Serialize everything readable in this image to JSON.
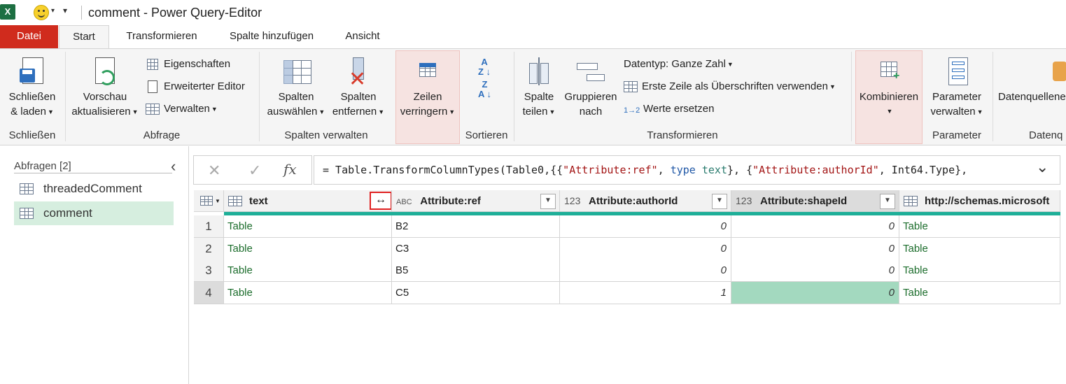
{
  "window": {
    "app_icon": "X",
    "title": "comment - Power Query-Editor",
    "qat_dropdown": "▾"
  },
  "tabs": [
    {
      "label": "Datei"
    },
    {
      "label": "Start"
    },
    {
      "label": "Transformieren"
    },
    {
      "label": "Spalte hinzufügen"
    },
    {
      "label": "Ansicht"
    }
  ],
  "ribbon": {
    "close_load": {
      "line1": "Schließen",
      "line2": "& laden"
    },
    "preview_refresh": {
      "line1": "Vorschau",
      "line2": "aktualisieren"
    },
    "properties": "Eigenschaften",
    "advanced_editor": "Erweiterter Editor",
    "manage": "Verwalten",
    "choose_columns": {
      "line1": "Spalten",
      "line2": "auswählen"
    },
    "remove_columns": {
      "line1": "Spalten",
      "line2": "entfernen"
    },
    "reduce_rows": {
      "line1": "Zeilen",
      "line2": "verringern"
    },
    "split_column": {
      "line1": "Spalte",
      "line2": "teilen"
    },
    "group_by": {
      "line1": "Gruppieren",
      "line2": "nach"
    },
    "data_type": "Datentyp: Ganze Zahl",
    "first_row_headers": "Erste Zeile als Überschriften verwenden",
    "replace_values": "Werte ersetzen",
    "replace_values_icon": "1→2",
    "combine": "Kombinieren",
    "manage_params": {
      "line1": "Parameter",
      "line2": "verwalten"
    },
    "data_source": "Datenquellene",
    "groups": {
      "close": "Schließen",
      "query": "Abfrage",
      "manage_columns": "Spalten verwalten",
      "sort": "Sortieren",
      "transform": "Transformieren",
      "parameters": "Parameter",
      "data_source": "Datenq"
    },
    "accent_color": "#d02b1d",
    "highlight_color": "#f6e3e1"
  },
  "queries": {
    "header": "Abfragen [2]",
    "items": [
      {
        "label": "threadedComment",
        "selected": false
      },
      {
        "label": "comment",
        "selected": true
      }
    ]
  },
  "formula": {
    "cancel_glyph": "✕",
    "confirm_glyph": "✓",
    "fx_glyph": "fx",
    "prefix": "= Table.TransformColumnTypes(Table0,{{",
    "s1": "\"Attribute:ref\"",
    "sep1": ", ",
    "kw1": "type",
    "t1": " text",
    "sep2": "}, {",
    "s2": "\"Attribute:authorId\"",
    "tail": ", Int64.Type},",
    "expand_glyph": "⌄"
  },
  "grid": {
    "columns": [
      {
        "label": "text",
        "type_icon": "table-icon"
      },
      {
        "label": "Attribute:ref",
        "type_icon": "ABC"
      },
      {
        "label": "Attribute:authorId",
        "type_icon": "123"
      },
      {
        "label": "Attribute:shapeId",
        "type_icon": "123"
      },
      {
        "label": "http://schemas.microsoft",
        "type_icon": "table-icon"
      }
    ],
    "rows": [
      {
        "n": "1",
        "text": "Table",
        "ref": "B2",
        "authorId": "0",
        "shapeId": "0",
        "http": "Table"
      },
      {
        "n": "2",
        "text": "Table",
        "ref": "C3",
        "authorId": "0",
        "shapeId": "0",
        "http": "Table"
      },
      {
        "n": "3",
        "text": "Table",
        "ref": "B5",
        "authorId": "0",
        "shapeId": "0",
        "http": "Table"
      },
      {
        "n": "4",
        "text": "Table",
        "ref": "C5",
        "authorId": "1",
        "shapeId": "0",
        "http": "Table"
      }
    ],
    "expand_icon_glyph": "↔",
    "abc_glyph": "ABC",
    "num_glyph": "123",
    "quality_bar_color": "#1eaf98",
    "selected_cell_color": "#a3d9bf"
  }
}
